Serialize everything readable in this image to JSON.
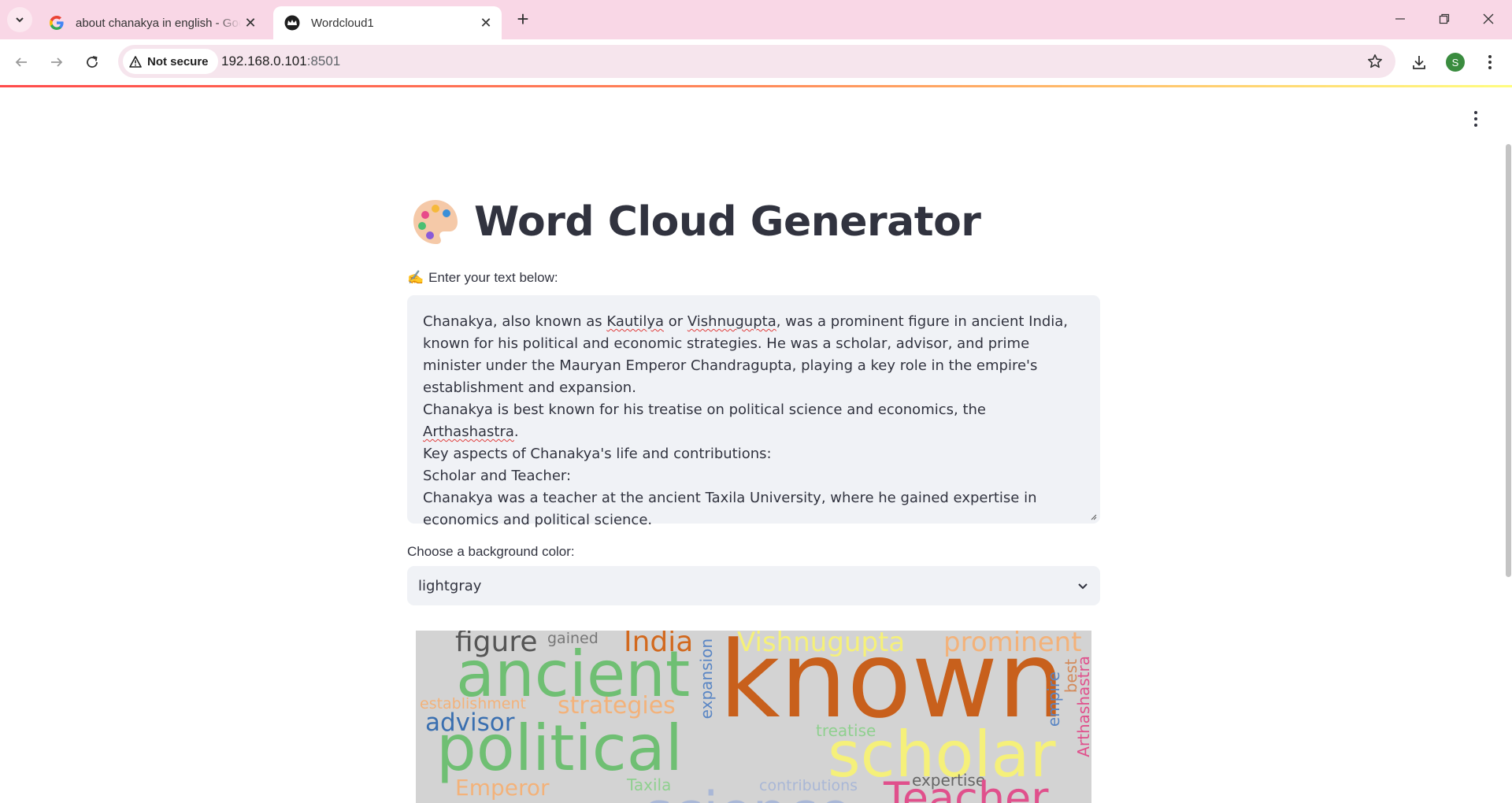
{
  "browser": {
    "tabs": [
      {
        "title": "about chanakya in english - Google Search",
        "favicon": "google-g-icon",
        "active": false
      },
      {
        "title": "Wordcloud1",
        "favicon": "streamlit-crown-icon",
        "active": true
      }
    ],
    "security_label": "Not secure",
    "url_host": "192.168.0.101",
    "url_port": ":8501",
    "profile_initial": "S"
  },
  "app": {
    "title_emoji": "🎨",
    "title": "Word Cloud Generator",
    "text_label_emoji": "✍️",
    "text_label": "Enter your text below:",
    "textarea": {
      "seg1": "Chanakya, also known as ",
      "w1": "Kautilya",
      "seg2": " or ",
      "w2": "Vishnugupta",
      "seg3": ", was a prominent figure in ancient India, known for his political and economic strategies. He was a scholar, advisor, and prime minister under the Mauryan Emperor Chandragupta, playing a key role in the empire's establishment and expansion.\nChanakya is best known for his treatise on political science and economics, the ",
      "w3": "Arthashastra",
      "seg4": ".\nKey aspects of Chanakya's life and contributions:\nScholar and Teacher:\nChanakya was a teacher at the ancient Taxila University, where he gained expertise in economics and political science."
    },
    "bg_color_label": "Choose a background color:",
    "bg_color_value": "lightgray",
    "wordcloud_background": "#d3d3d3",
    "wordcloud_words": [
      {
        "text": "known",
        "color": "#c8601c"
      },
      {
        "text": "ancient",
        "color": "#6fbf73"
      },
      {
        "text": "political",
        "color": "#6fbf73"
      },
      {
        "text": "scholar",
        "color": "#f5f07a"
      },
      {
        "text": "India",
        "color": "#d2691e"
      },
      {
        "text": "Vishnugupta",
        "color": "#f5f07a"
      },
      {
        "text": "prominent",
        "color": "#f3b27a"
      },
      {
        "text": "figure",
        "color": "#555555"
      },
      {
        "text": "gained",
        "color": "#777777"
      },
      {
        "text": "advisor",
        "color": "#3a6fb0"
      },
      {
        "text": "strategies",
        "color": "#f3b27a"
      },
      {
        "text": "establishment",
        "color": "#f3b27a"
      },
      {
        "text": "expansion",
        "color": "#5a86c4"
      },
      {
        "text": "treatise",
        "color": "#8fd08f"
      },
      {
        "text": "empire",
        "color": "#5a86c4"
      },
      {
        "text": "best",
        "color": "#d38a5a"
      },
      {
        "text": "Arthashastra",
        "color": "#e0508c"
      },
      {
        "text": "expertise",
        "color": "#666666"
      },
      {
        "text": "Taxila",
        "color": "#8fd08f"
      },
      {
        "text": "contributions",
        "color": "#a9b7d6"
      },
      {
        "text": "Emperor",
        "color": "#f3b27a"
      },
      {
        "text": "Teacher",
        "color": "#e0508c"
      },
      {
        "text": "science",
        "color": "#a9b7d6"
      }
    ]
  }
}
